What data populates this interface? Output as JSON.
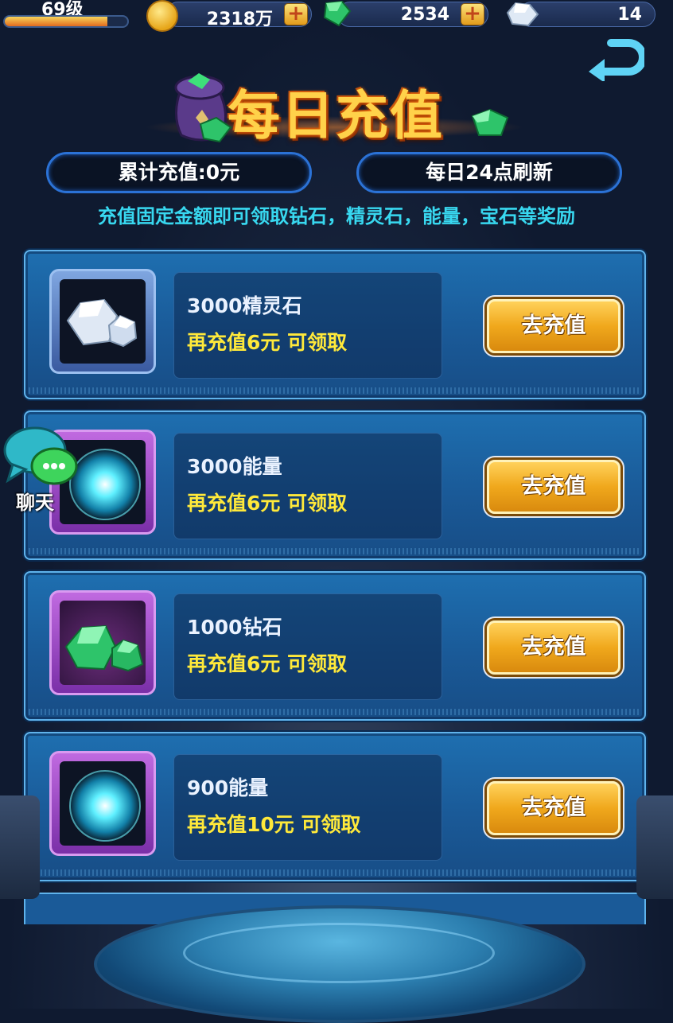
{
  "topbar": {
    "level": "69级",
    "level_progress": 0.84,
    "gold": "2318万",
    "green_gem": "2534",
    "white_gem": "14",
    "plus_symbol": "+"
  },
  "title": "每日充值",
  "info": {
    "total": "累计充值:0元",
    "refresh": "每日24点刷新"
  },
  "description": "充值固定金额即可领取钻石，精灵石，能量，宝石等奖励",
  "cards": [
    {
      "icon": "spirit-stone-icon",
      "name": "3000精灵石",
      "condition": "再充值6元  可领取",
      "button": "去充值"
    },
    {
      "icon": "energy-orb-icon",
      "name": "3000能量",
      "condition": "再充值6元  可领取",
      "button": "去充值"
    },
    {
      "icon": "diamond-icon",
      "name": "1000钻石",
      "condition": "再充值6元  可领取",
      "button": "去充值"
    },
    {
      "icon": "energy-orb-icon",
      "name": "900能量",
      "condition": "再充值10元  可领取",
      "button": "去充值"
    }
  ],
  "chat": {
    "label": "聊天"
  },
  "colors": {
    "accent": "#38d8f0",
    "highlight": "#ffe93a",
    "button": "#f0a81c",
    "card": "#1a5a98"
  }
}
